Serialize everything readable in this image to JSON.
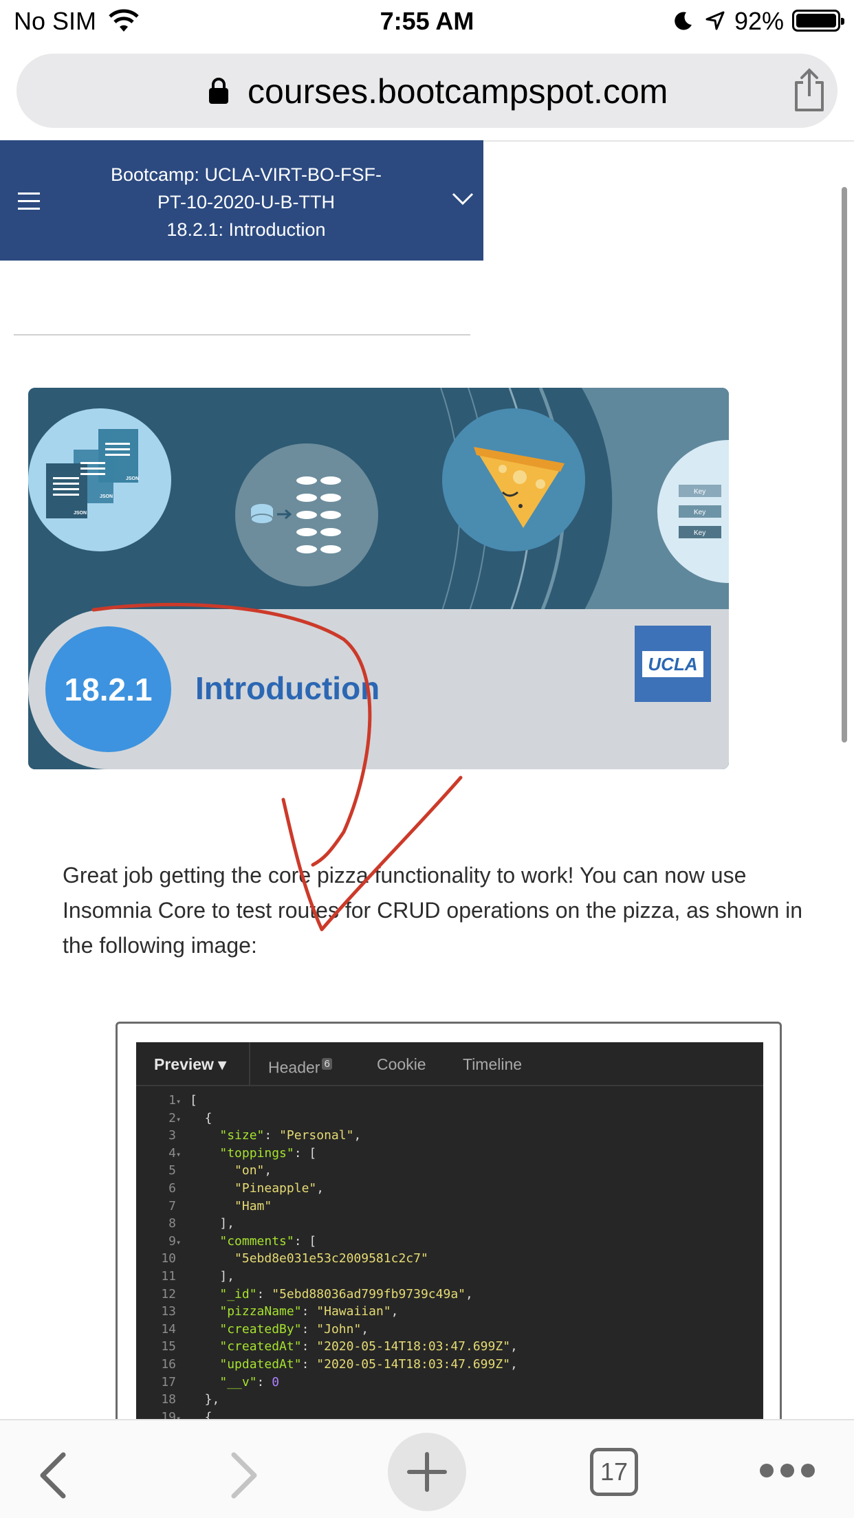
{
  "status_bar": {
    "carrier": "No SIM",
    "time": "7:55 AM",
    "battery_percent": "92%",
    "icons": [
      "wifi-icon",
      "moon-icon",
      "location-arrow-icon",
      "battery-icon"
    ]
  },
  "browser": {
    "url": "courses.bootcampspot.com",
    "icons": [
      "lock-icon",
      "share-icon"
    ]
  },
  "course_header": {
    "line1": "Bootcamp: UCLA-VIRT-BO-FSF-",
    "line2": "PT-10-2020-U-B-TTH",
    "line3": "18.2.1: Introduction",
    "icons": [
      "hamburger-menu-icon",
      "chevron-down-icon"
    ]
  },
  "banner": {
    "lesson_number": "18.2.1",
    "lesson_title": "Introduction",
    "logo_text": "UCLA",
    "icon_labels": {
      "json1": "JSON",
      "json2": "JSON",
      "json3": "JSON",
      "key1": "Key",
      "key2": "Key",
      "key3": "Key"
    },
    "colors": {
      "banner_bg": "#2e5a73",
      "badge": "#3d93df",
      "title": "#2b67b3"
    }
  },
  "paragraph": "Great job getting the core pizza functionality to work! You can now use Insomnia Core to test routes for CRUD operations on the pizza, as shown in the following image:",
  "code_image": {
    "tabs": {
      "preview": "Preview",
      "header": "Header",
      "header_count": "6",
      "cookie": "Cookie",
      "timeline": "Timeline"
    },
    "line_numbers": [
      "1",
      "2",
      "3",
      "4",
      "5",
      "6",
      "7",
      "8",
      "9",
      "10",
      "11",
      "12",
      "13",
      "14",
      "15",
      "16",
      "17",
      "18",
      "19"
    ],
    "lines": {
      "l1": "[",
      "l2": "  {",
      "l3_key": "\"size\"",
      "l3_val": "\"Personal\"",
      "l4_key": "\"toppings\"",
      "l5": "\"on\"",
      "l6": "\"Pineapple\"",
      "l7": "\"Ham\"",
      "l8": "    ],",
      "l9_key": "\"comments\"",
      "l10": "\"5ebd8e031e53c2009581c2c7\"",
      "l11": "    ],",
      "l12_key": "\"_id\"",
      "l12_val": "\"5ebd88036ad799fb9739c49a\"",
      "l13_key": "\"pizzaName\"",
      "l13_val": "\"Hawaiian\"",
      "l14_key": "\"createdBy\"",
      "l14_val": "\"John\"",
      "l15_key": "\"createdAt\"",
      "l15_val": "\"2020-05-14T18:03:47.699Z\"",
      "l16_key": "\"updatedAt\"",
      "l16_val": "\"2020-05-14T18:03:47.699Z\"",
      "l17_key": "\"__v\"",
      "l17_val": "0",
      "l18": "  },",
      "l19": "  {"
    }
  },
  "toolbar": {
    "tab_count": "17",
    "icons": [
      "back-icon",
      "forward-icon",
      "new-tab-icon",
      "tabs-icon",
      "more-icon"
    ]
  },
  "annotation_color": "#cc3a2a"
}
